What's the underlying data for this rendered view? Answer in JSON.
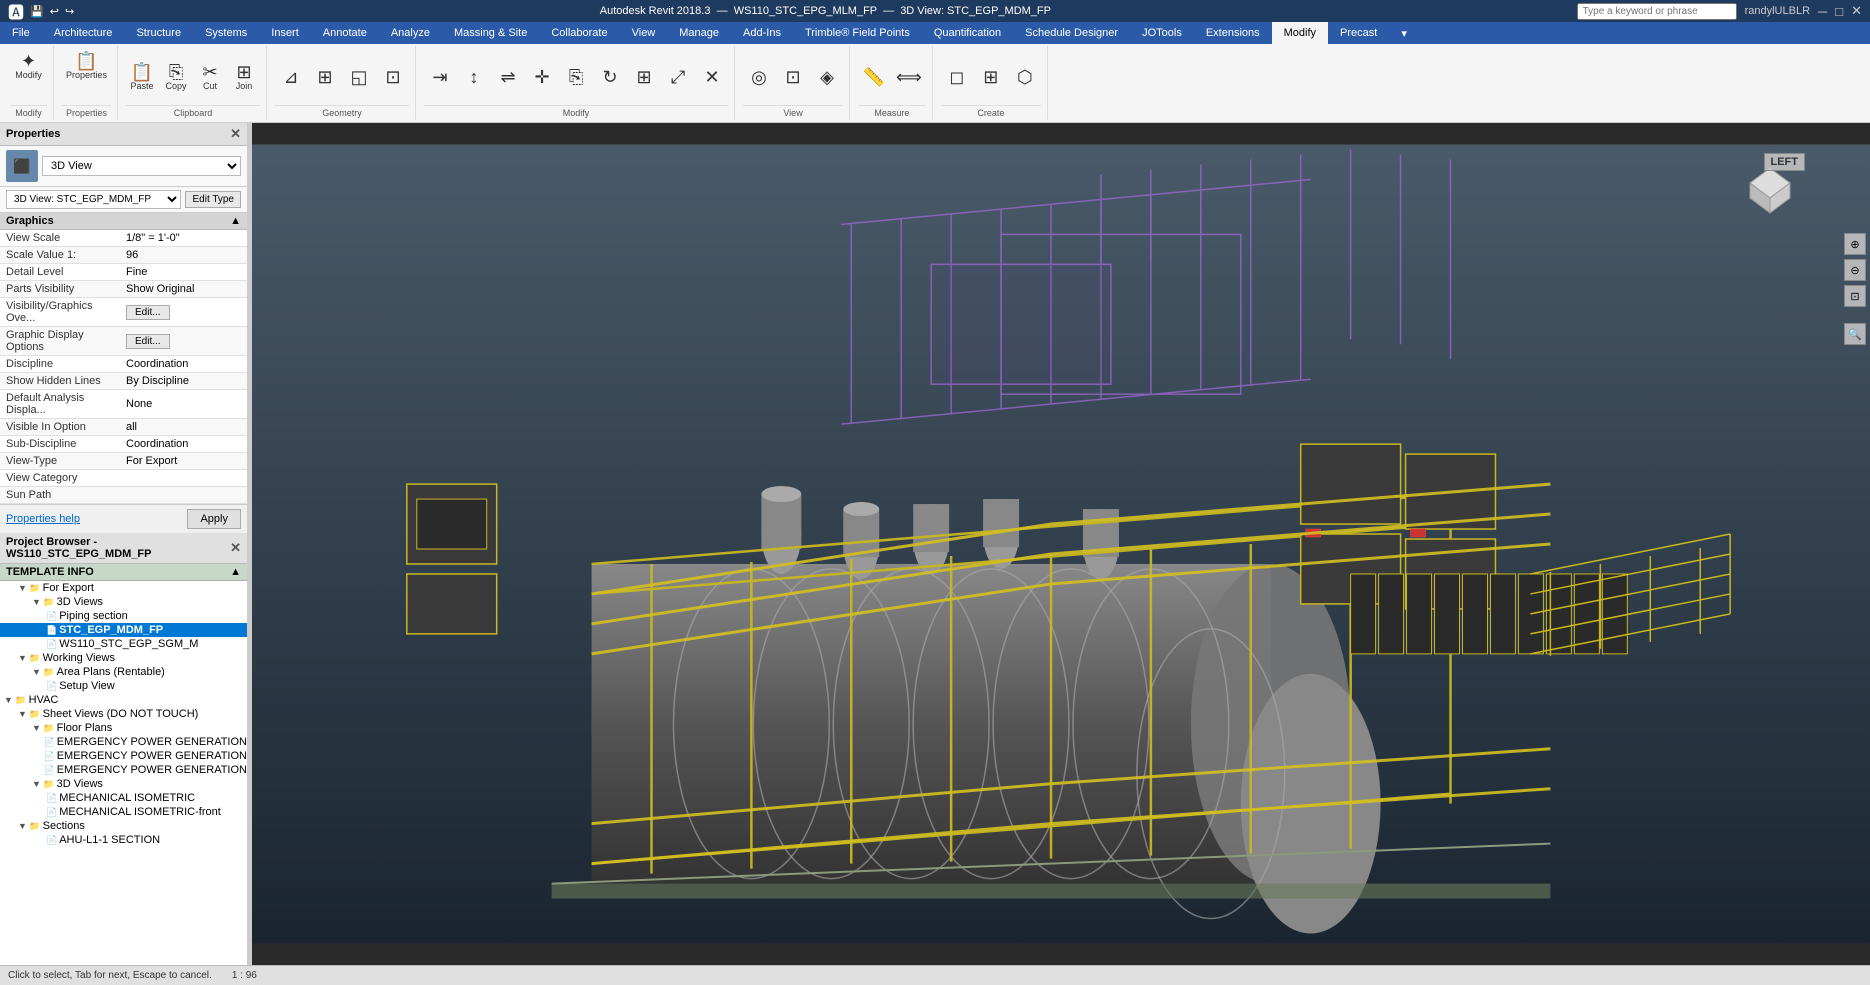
{
  "titleBar": {
    "appName": "Autodesk Revit 2018.3",
    "fileName": "WS110_STC_EPG_MLM_FP",
    "viewName": "3D View: STC_EGP_MDM_FP",
    "searchPlaceholder": "Type a keyword or phrase",
    "userName": "randylULBLR",
    "windowControls": [
      "minimize",
      "restore",
      "close"
    ]
  },
  "ribbon": {
    "tabs": [
      "File",
      "Architecture",
      "Structure",
      "Systems",
      "Insert",
      "Annotate",
      "Analyze",
      "Massing & Site",
      "Collaborate",
      "View",
      "Manage",
      "Add-Ins",
      "Trimble® Field Points",
      "Quantification",
      "Schedule Designer",
      "JOTools",
      "Extensions",
      "Modify",
      "Precast"
    ],
    "activeTab": "Modify",
    "groups": [
      {
        "label": "Modify",
        "buttons": [
          "Modify"
        ]
      },
      {
        "label": "Properties",
        "buttons": [
          "Properties"
        ]
      },
      {
        "label": "Clipboard",
        "buttons": [
          "Paste",
          "Copy",
          "Cut",
          "Join"
        ]
      },
      {
        "label": "Geometry",
        "buttons": []
      },
      {
        "label": "Modify",
        "buttons": []
      },
      {
        "label": "View",
        "buttons": []
      },
      {
        "label": "Measure",
        "buttons": []
      },
      {
        "label": "Create",
        "buttons": []
      }
    ]
  },
  "properties": {
    "title": "Properties",
    "viewType": "3D View",
    "viewName": "3D View: STC_EGP_MDM_FP",
    "editTypeLabel": "Edit Type",
    "sectionHeader": "Graphics",
    "rows": [
      {
        "label": "View Scale",
        "value": "1/8\" = 1'-0\""
      },
      {
        "label": "Scale Value  1:",
        "value": "96"
      },
      {
        "label": "Detail Level",
        "value": "Fine"
      },
      {
        "label": "Parts Visibility",
        "value": "Show Original"
      },
      {
        "label": "Visibility/Graphics Ove...",
        "value": "",
        "hasButton": true,
        "buttonLabel": "Edit..."
      },
      {
        "label": "Graphic Display Options",
        "value": "",
        "hasButton": true,
        "buttonLabel": "Edit..."
      },
      {
        "label": "Discipline",
        "value": "Coordination"
      },
      {
        "label": "Show Hidden Lines",
        "value": "By Discipline"
      },
      {
        "label": "Default Analysis Displa...",
        "value": "None"
      },
      {
        "label": "Visible In Option",
        "value": "all"
      },
      {
        "label": "Sub-Discipline",
        "value": "Coordination"
      },
      {
        "label": "View-Type",
        "value": "For Export"
      },
      {
        "label": "View Category",
        "value": ""
      },
      {
        "label": "Sun Path",
        "value": ""
      }
    ],
    "helpLink": "Properties help",
    "applyLabel": "Apply"
  },
  "projectBrowser": {
    "title": "Project Browser - WS110_STC_EPG_MDM_FP",
    "templateInfo": "TEMPLATE INFO",
    "tree": [
      {
        "label": "For Export",
        "level": 1,
        "type": "folder",
        "expanded": true
      },
      {
        "label": "3D Views",
        "level": 2,
        "type": "folder",
        "expanded": true
      },
      {
        "label": "Piping section",
        "level": 3,
        "type": "view"
      },
      {
        "label": "STC_EGP_MDM_FP",
        "level": 3,
        "type": "view",
        "selected": true,
        "bold": true
      },
      {
        "label": "WS110_STC_EGP_SGM_M",
        "level": 3,
        "type": "view"
      },
      {
        "label": "Working Views",
        "level": 1,
        "type": "folder",
        "expanded": true
      },
      {
        "label": "Area Plans (Rentable)",
        "level": 2,
        "type": "folder",
        "expanded": true
      },
      {
        "label": "Setup View",
        "level": 3,
        "type": "view"
      },
      {
        "label": "HVAC",
        "level": 0,
        "type": "folder",
        "expanded": true
      },
      {
        "label": "Sheet Views (DO NOT TOUCH)",
        "level": 1,
        "type": "folder",
        "expanded": true
      },
      {
        "label": "Floor Plans",
        "level": 2,
        "type": "folder",
        "expanded": true
      },
      {
        "label": "EMERGENCY POWER GENERATION",
        "level": 3,
        "type": "view"
      },
      {
        "label": "EMERGENCY POWER GENERATION",
        "level": 3,
        "type": "view"
      },
      {
        "label": "EMERGENCY POWER GENERATION",
        "level": 3,
        "type": "view"
      },
      {
        "label": "3D Views",
        "level": 2,
        "type": "folder",
        "expanded": true
      },
      {
        "label": "MECHANICAL ISOMETRIC",
        "level": 3,
        "type": "view"
      },
      {
        "label": "MECHANICAL ISOMETRIC-front",
        "level": 3,
        "type": "view"
      },
      {
        "label": "Sections",
        "level": 1,
        "type": "folder",
        "expanded": true
      },
      {
        "label": "AHU-L1-1 SECTION",
        "level": 3,
        "type": "view"
      }
    ]
  },
  "viewCube": {
    "label": "LEFT"
  },
  "statusBar": {
    "text": ""
  }
}
